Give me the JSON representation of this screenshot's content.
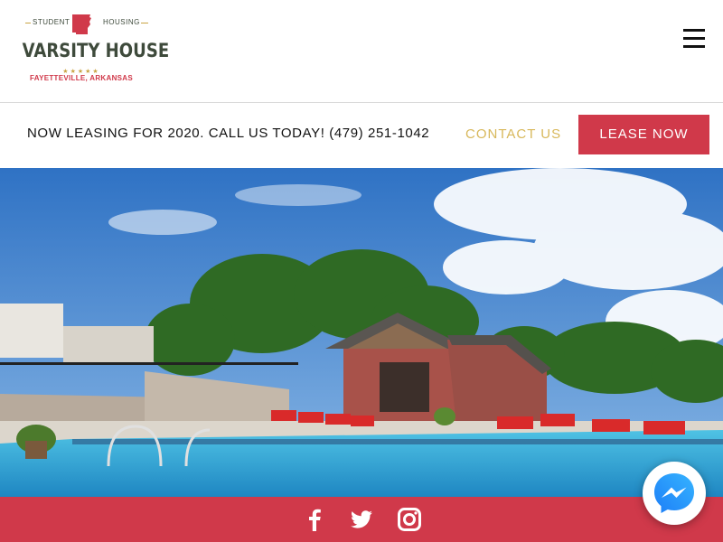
{
  "logo": {
    "tag_left": "STUDENT",
    "tag_right": "HOUSING",
    "name": "VARSITY HOUSE",
    "stars": "★★★★★",
    "city": "FAYETTEVILLE, ARKANSAS"
  },
  "header": {
    "menu_icon": "hamburger-menu-icon"
  },
  "bar": {
    "announcement": "NOW LEASING FOR 2020. CALL US TODAY! (479) 251-1042",
    "contact_label": "CONTACT US",
    "lease_label": "LEASE NOW"
  },
  "hero": {
    "image": "pool-and-pavilion-photo"
  },
  "social": {
    "icons": [
      "facebook-icon",
      "twitter-icon",
      "instagram-icon"
    ]
  },
  "chat": {
    "icon": "messenger-icon"
  },
  "colors": {
    "brand_red": "#d0394a",
    "gold": "#d8b85b",
    "logo_green": "#3e4a3b"
  }
}
